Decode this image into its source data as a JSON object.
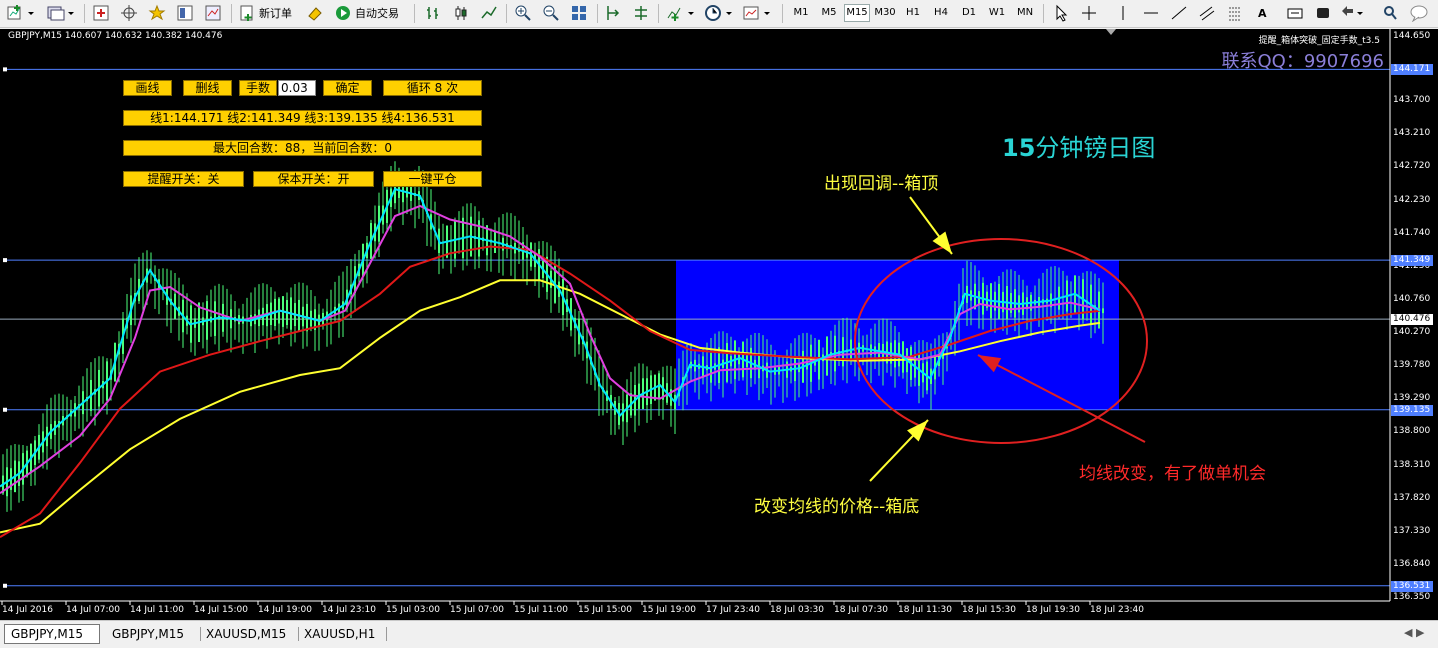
{
  "toolbar": {
    "new_order": "新订单",
    "auto_trading": "自动交易",
    "timeframes": [
      "M1",
      "M5",
      "M15",
      "M30",
      "H1",
      "H4",
      "D1",
      "W1",
      "MN"
    ],
    "selected_timeframe": "M15"
  },
  "chart": {
    "symbol_info": "GBPJPY,M15  140.607 140.632 140.382 140.476",
    "ea_info": "提醒_箱体突破_固定手数_t3.5",
    "contact": "联系QQ：9907696",
    "panel": {
      "draw_line": "画线",
      "delete_line": "删线",
      "lots_label": "手数",
      "lots_value": "0.03",
      "confirm": "确定",
      "loop": "循环 8 次",
      "lines_info": "线1:144.171 线2:141.349 线3:139.135 线4:136.531",
      "rounds_info": "最大回合数：88，当前回合数：0",
      "alert_toggle": "提醒开关：关",
      "breakeven_toggle": "保本开关：开",
      "close_all": "一键平仓"
    },
    "annotations": {
      "title_num": "15",
      "title_text": "分钟镑日图",
      "box_top": "出现回调--箱顶",
      "box_bottom": "改变均线的价格--箱底",
      "ma_change": "均线改变，有了做单机会"
    },
    "price_labels": [
      "144.650",
      "143.700",
      "143.210",
      "142.720",
      "142.230",
      "141.740",
      "141.250",
      "140.760",
      "140.270",
      "139.780",
      "139.290",
      "138.800",
      "138.310",
      "137.820",
      "137.330",
      "136.840",
      "136.350"
    ],
    "price_tags": {
      "line1": "144.171",
      "line2": "141.349",
      "current": "140.476",
      "line3": "139.135",
      "line4": "136.531"
    },
    "time_labels": [
      "14 Jul 2016",
      "14 Jul 07:00",
      "14 Jul 11:00",
      "14 Jul 15:00",
      "14 Jul 19:00",
      "14 Jul 23:10",
      "15 Jul 03:00",
      "15 Jul 07:00",
      "15 Jul 11:00",
      "15 Jul 15:00",
      "15 Jul 19:00",
      "17 Jul 23:40",
      "18 Jul 03:30",
      "18 Jul 07:30",
      "18 Jul 11:30",
      "18 Jul 15:30",
      "18 Jul 19:30",
      "18 Jul 23:40"
    ],
    "colors": {
      "background": "#000000",
      "candles": "#4cff7a",
      "ma_fast": "#00e5ff",
      "ma_magenta": "#e040e0",
      "ma_red": "#e01818",
      "ma_yellow": "#ffff30",
      "box": "#0000ff",
      "hlines": "#4f7fff",
      "ellipse": "#e02020",
      "panel": "#ffd000"
    }
  },
  "tabs": {
    "items": [
      "GBPJPY,M15",
      "GBPJPY,M15",
      "XAUUSD,M15",
      "XAUUSD,H1"
    ]
  }
}
